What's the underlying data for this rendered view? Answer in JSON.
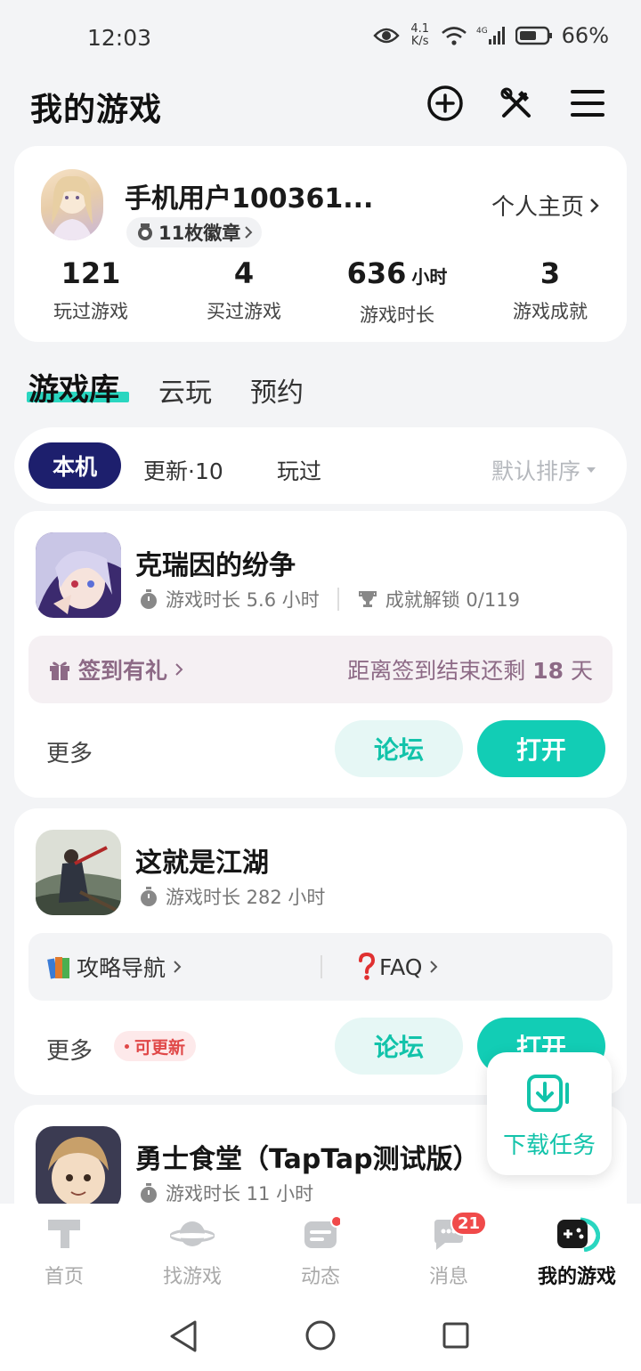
{
  "status": {
    "time": "12:03",
    "speed_top": "4.1",
    "speed_unit": "K/s",
    "battery": "66%"
  },
  "header": {
    "title": "我的游戏"
  },
  "profile": {
    "username": "手机用户100361...",
    "badge": "11枚徽章",
    "homepage": "个人主页",
    "stats": [
      {
        "value": "121",
        "unit": "",
        "label": "玩过游戏"
      },
      {
        "value": "4",
        "unit": "",
        "label": "买过游戏"
      },
      {
        "value": "636",
        "unit": "小时",
        "label": "游戏时长"
      },
      {
        "value": "3",
        "unit": "",
        "label": "游戏成就"
      }
    ]
  },
  "tabs": {
    "active": "游戏库",
    "items": [
      "云玩",
      "预约"
    ]
  },
  "filter": {
    "active": "本机",
    "update": "更新·10",
    "played": "玩过",
    "sort": "默认排序"
  },
  "games": [
    {
      "name": "克瑞因的纷争",
      "playtime": "游戏时长 5.6 小时",
      "achievement": "成就解锁 0/119",
      "promo_label": "签到有礼",
      "promo_right_prefix": "距离签到结束还剩 ",
      "promo_right_days": "18",
      "promo_right_suffix": " 天",
      "more": "更多",
      "forum": "论坛",
      "open": "打开"
    },
    {
      "name": "这就是江湖",
      "playtime": "游戏时长 282 小时",
      "guide": "攻略导航",
      "faq": "FAQ",
      "more": "更多",
      "update_badge": "可更新",
      "forum": "论坛",
      "open": "打开"
    },
    {
      "name": "勇士食堂（TapTap测试版）",
      "playtime": "游戏时长 11 小时"
    }
  ],
  "download": {
    "label": "下载任务"
  },
  "nav": [
    {
      "label": "首页"
    },
    {
      "label": "找游戏"
    },
    {
      "label": "动态"
    },
    {
      "label": "消息",
      "badge": "21"
    },
    {
      "label": "我的游戏"
    }
  ],
  "colors": {
    "accent": "#12cdb5",
    "active_pill": "#1d1f6d",
    "promo_text": "#8d6a86"
  }
}
